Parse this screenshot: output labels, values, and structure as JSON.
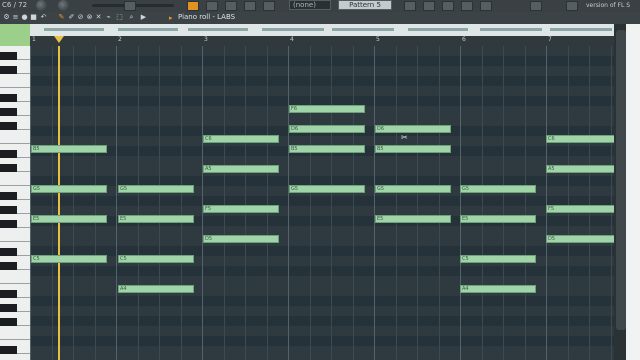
{
  "toolbar": {
    "counter": "C6 / 72",
    "pattern_select": "(none)",
    "pattern_name": "Pattern 5",
    "version_text": "version of FL S"
  },
  "piano_roll": {
    "title": "Piano roll - LABS",
    "tools": [
      "wrench-icon",
      "sliders-icon",
      "record-icon",
      "undo-icon",
      "pencil-icon",
      "brush-icon",
      "delete-icon",
      "mute-icon",
      "slice-icon",
      "select-icon",
      "zoom-icon",
      "play-icon"
    ]
  },
  "ruler": {
    "bars": [
      "1",
      "2",
      "3",
      "4",
      "5",
      "6",
      "7"
    ]
  },
  "keyboard": {
    "labels": [
      "C6",
      "C5"
    ]
  },
  "notes": [
    {
      "label": "B5",
      "col": 0,
      "row": 6,
      "w": "short"
    },
    {
      "label": "G5",
      "col": 0,
      "row": 10,
      "w": "short"
    },
    {
      "label": "E5",
      "col": 0,
      "row": 13,
      "w": "short"
    },
    {
      "label": "C5",
      "col": 0,
      "row": 17,
      "w": "short"
    },
    {
      "label": "G5",
      "col": 1,
      "row": 10,
      "w": "short"
    },
    {
      "label": "E5",
      "col": 1,
      "row": 13,
      "w": "short"
    },
    {
      "label": "C5",
      "col": 1,
      "row": 17,
      "w": "short"
    },
    {
      "label": "A4",
      "col": 1,
      "row": 20,
      "w": "short"
    },
    {
      "label": "C6",
      "col": 2,
      "row": 5,
      "w": "short"
    },
    {
      "label": "A5",
      "col": 2,
      "row": 8,
      "w": "short"
    },
    {
      "label": "F5",
      "col": 2,
      "row": 12,
      "w": "short"
    },
    {
      "label": "D5",
      "col": 2,
      "row": 15,
      "w": "short"
    },
    {
      "label": "F6",
      "col": 3,
      "row": 2,
      "w": "short"
    },
    {
      "label": "D6",
      "col": 3,
      "row": 4,
      "w": "short"
    },
    {
      "label": "B5",
      "col": 3,
      "row": 6,
      "w": "short"
    },
    {
      "label": "G5",
      "col": 3,
      "row": 10,
      "w": "short"
    },
    {
      "label": "D6",
      "col": 4,
      "row": 4,
      "w": "short"
    },
    {
      "label": "B5",
      "col": 4,
      "row": 6,
      "w": "short"
    },
    {
      "label": "G5",
      "col": 4,
      "row": 10,
      "w": "short"
    },
    {
      "label": "E5",
      "col": 4,
      "row": 13,
      "w": "short"
    },
    {
      "label": "G5",
      "col": 5,
      "row": 10,
      "w": "short"
    },
    {
      "label": "E5",
      "col": 5,
      "row": 13,
      "w": "short"
    },
    {
      "label": "C5",
      "col": 5,
      "row": 17,
      "w": "short"
    },
    {
      "label": "A4",
      "col": 5,
      "row": 20,
      "w": "short"
    },
    {
      "label": "C6",
      "col": 6,
      "row": 5,
      "w": "short"
    },
    {
      "label": "A5",
      "col": 6,
      "row": 8,
      "w": "short"
    },
    {
      "label": "F5",
      "col": 6,
      "row": 12,
      "w": "short"
    },
    {
      "label": "D5",
      "col": 6,
      "row": 15,
      "w": "short"
    }
  ]
}
